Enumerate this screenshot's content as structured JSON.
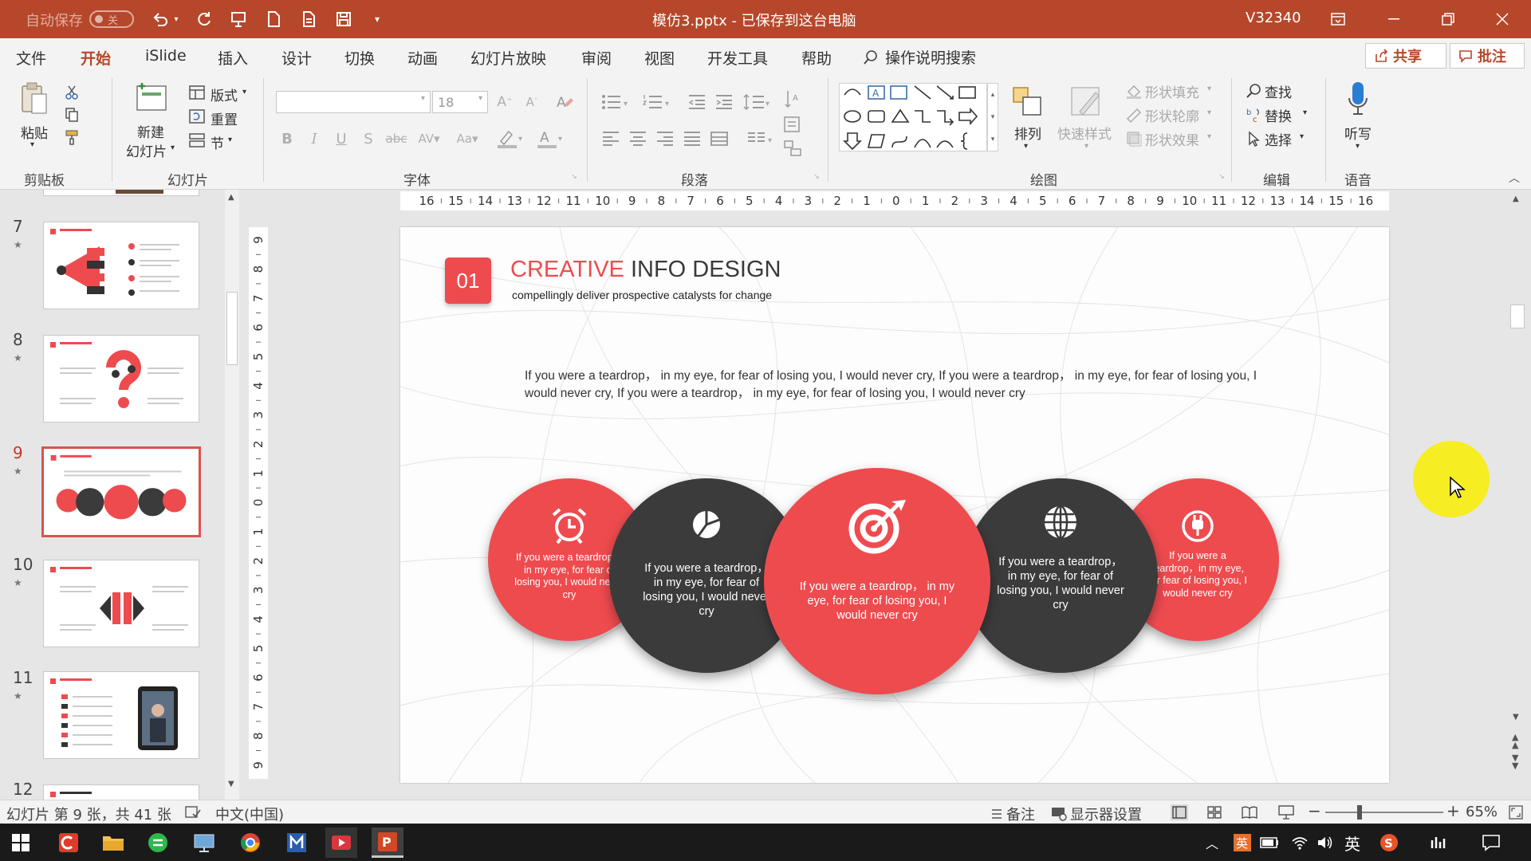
{
  "titlebar": {
    "autosave_label": "自动保存",
    "autosave_state": "关",
    "doc_title": "模仿3.pptx  -  已保存到这台电脑",
    "user": "V32340"
  },
  "menu": {
    "items": [
      "文件",
      "开始",
      "iSlide",
      "插入",
      "设计",
      "切换",
      "动画",
      "幻灯片放映",
      "审阅",
      "视图",
      "开发工具",
      "帮助"
    ],
    "active": "开始",
    "search_label": "操作说明搜索",
    "share_label": "共享",
    "comment_label": "批注"
  },
  "ribbon": {
    "clipboard": {
      "paste": "粘贴",
      "group": "剪贴板"
    },
    "slides": {
      "new_slide_1": "新建",
      "new_slide_2": "幻灯片",
      "layout": "版式",
      "reset": "重置",
      "section": "节",
      "group": "幻灯片"
    },
    "font": {
      "font_name": "",
      "font_size": "18",
      "group": "字体"
    },
    "paragraph": {
      "group": "段落"
    },
    "drawing": {
      "arrange": "排列",
      "quick_styles": "快速样式",
      "shape_fill": "形状填充",
      "shape_outline": "形状轮廓",
      "shape_effects": "形状效果",
      "group": "绘图"
    },
    "editing": {
      "find": "查找",
      "replace": "替换",
      "select": "选择",
      "group": "编辑"
    },
    "voice": {
      "dictate": "听写",
      "group": "语音"
    }
  },
  "ruler": {
    "h_ticks": [
      "16",
      "15",
      "14",
      "13",
      "12",
      "11",
      "10",
      "9",
      "8",
      "7",
      "6",
      "5",
      "4",
      "3",
      "2",
      "1",
      "0",
      "1",
      "2",
      "3",
      "4",
      "5",
      "6",
      "7",
      "8",
      "9",
      "10",
      "11",
      "12",
      "13",
      "14",
      "15",
      "16"
    ],
    "v_ticks": [
      "9",
      "8",
      "7",
      "6",
      "5",
      "4",
      "3",
      "2",
      "1",
      "0",
      "1",
      "2",
      "3",
      "4",
      "5",
      "6",
      "7",
      "8",
      "9"
    ]
  },
  "thumbnails": {
    "items": [
      {
        "num": "7",
        "selected": false
      },
      {
        "num": "8",
        "selected": false
      },
      {
        "num": "9",
        "selected": true
      },
      {
        "num": "10",
        "selected": false
      },
      {
        "num": "11",
        "selected": false
      },
      {
        "num": "12",
        "selected": false
      }
    ]
  },
  "slide": {
    "badge": "01",
    "title_accent": "CREATIVE",
    "title_rest": " INFO DESIGN",
    "subtitle": "compellingly deliver prospective catalysts for change",
    "paragraph": "If you were a teardrop，  in my eye,  for fear of losing you,   I  would never cry,   If you were a teardrop，  in my eye,  for fear of losing you,   I  would never cry,   If you were a teardrop，  in my eye,  for fear of losing you,   I  would never cry",
    "circles": [
      {
        "icon": "alarm-clock-icon",
        "text": "If you were a teardrop，in my eye,  for fear of losing you,   I  would never cry",
        "color": "#ee4b4f"
      },
      {
        "icon": "pie-chart-icon",
        "text": "If you were a teardrop，in my eye,  for fear of losing you,   I  would never cry",
        "color": "#3b3b3b"
      },
      {
        "icon": "target-icon",
        "text": "If you were a teardrop，  in my eye,  for fear of losing you,   I  would never cry",
        "color": "#ee4b4f"
      },
      {
        "icon": "globe-icon",
        "text": "If you were a teardrop，in my eye,  for fear of losing you,   I  would never cry",
        "color": "#3b3b3b"
      },
      {
        "icon": "plug-icon",
        "text": "If you were a teardrop，in my eye,  for fear of losing you,   I  would never cry",
        "color": "#ee4b4f"
      }
    ]
  },
  "statusbar": {
    "slide_info": "幻灯片 第 9 张，共 41 张",
    "language": "中文(中国)",
    "notes": "备注",
    "display_settings": "显示器设置",
    "zoom": "65%"
  },
  "taskbar": {
    "ime": "英"
  },
  "colors": {
    "brand": "#b7472a",
    "accent_red": "#ee4b4f",
    "dark_circle": "#3b3b3b"
  }
}
